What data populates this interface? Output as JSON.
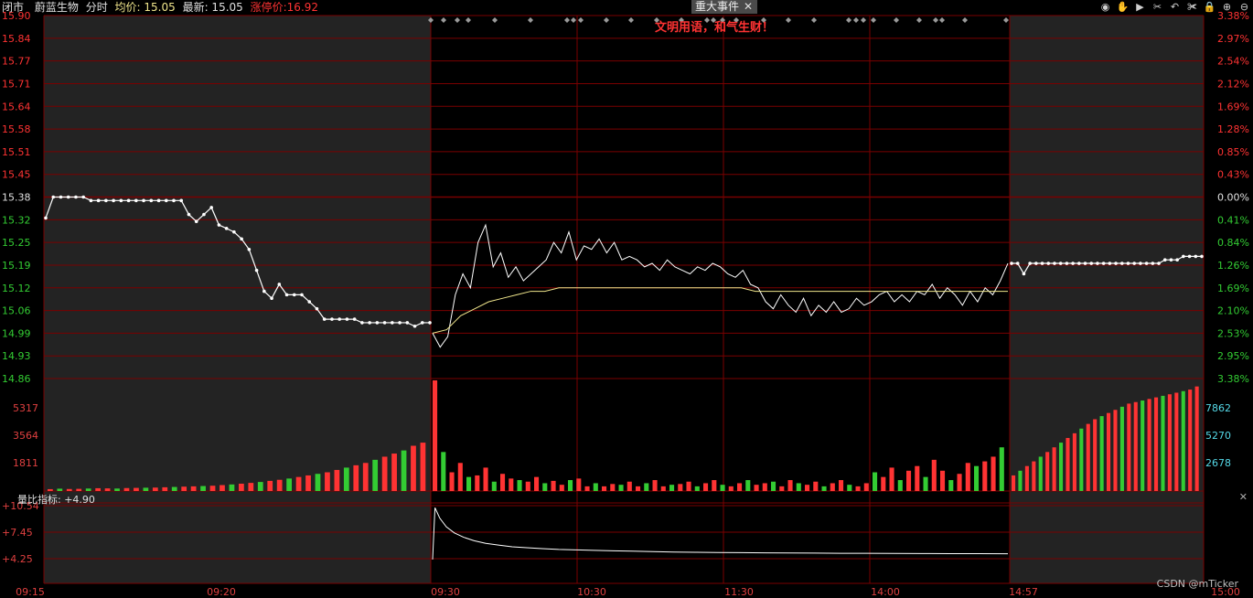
{
  "header": {
    "status": "闭市",
    "stock_name": "蔚蓝生物",
    "mode": "分时",
    "avg_label": "均价: 15.05",
    "last_label": "最新: 15.05",
    "limit_label": "涨停价:16.92",
    "event_tab": "重大事件",
    "event_close": "✕",
    "banner": "文明用语，和气生财！",
    "tools": [
      {
        "name": "eye-icon",
        "glyph": "◉"
      },
      {
        "name": "hand-icon",
        "glyph": "✋"
      },
      {
        "name": "play-icon",
        "glyph": "▶"
      },
      {
        "name": "tools-icon",
        "glyph": "✂"
      },
      {
        "name": "undo-icon",
        "glyph": "↶"
      },
      {
        "name": "scissors-icon",
        "glyph": "✀"
      },
      {
        "name": "lock-icon",
        "glyph": "🔒"
      },
      {
        "name": "zoom-in-icon",
        "glyph": "⊕"
      },
      {
        "name": "zoom-out-icon",
        "glyph": "⊖"
      }
    ]
  },
  "indicator": {
    "title": "量比指标: +4.90",
    "close": "✕"
  },
  "watermark": "CSDN @mTicker",
  "colors": {
    "up": "#ff3333",
    "down": "#33cc33",
    "grid": "#7a0000",
    "price_line": "#ffffff",
    "avg_line": "#f0e68c",
    "session_bg": "#232323",
    "volume_axis": "#55d9e8"
  },
  "chart_data": [
    {
      "type": "line",
      "name": "price",
      "ylim": [
        14.86,
        15.9
      ],
      "y_ticks_left": [
        "15.90",
        "15.84",
        "15.77",
        "15.71",
        "15.64",
        "15.58",
        "15.51",
        "15.45",
        "15.38",
        "15.32",
        "15.25",
        "15.19",
        "15.12",
        "15.06",
        "14.99",
        "14.93",
        "14.86"
      ],
      "y_ticks_right": [
        "3.38%",
        "2.97%",
        "2.54%",
        "2.12%",
        "1.69%",
        "1.28%",
        "0.85%",
        "0.43%",
        "0.00%",
        "0.41%",
        "0.84%",
        "1.26%",
        "1.69%",
        "2.10%",
        "2.53%",
        "2.95%",
        "3.38%"
      ],
      "prev_close": 15.38,
      "x_ticks": [
        "09:15",
        "09:20",
        "09:30",
        "10:30",
        "11:30",
        "14:00",
        "14:57",
        "15:00"
      ],
      "preauction": [
        15.32,
        15.38,
        15.38,
        15.38,
        15.38,
        15.38,
        15.37,
        15.37,
        15.37,
        15.37,
        15.37,
        15.37,
        15.37,
        15.37,
        15.37,
        15.37,
        15.37,
        15.37,
        15.37,
        15.33,
        15.31,
        15.33,
        15.35,
        15.3,
        15.29,
        15.28,
        15.26,
        15.23,
        15.17,
        15.11,
        15.09,
        15.13,
        15.1,
        15.1,
        15.1,
        15.08,
        15.06,
        15.03,
        15.03,
        15.03,
        15.03,
        15.03,
        15.02,
        15.02,
        15.02,
        15.02,
        15.02,
        15.02,
        15.02,
        15.01,
        15.02,
        15.02
      ],
      "session_price": [
        14.99,
        14.95,
        14.98,
        15.1,
        15.16,
        15.12,
        15.25,
        15.3,
        15.18,
        15.22,
        15.15,
        15.18,
        15.14,
        15.16,
        15.18,
        15.2,
        15.25,
        15.22,
        15.28,
        15.2,
        15.24,
        15.23,
        15.26,
        15.22,
        15.25,
        15.2,
        15.21,
        15.2,
        15.18,
        15.19,
        15.17,
        15.2,
        15.18,
        15.17,
        15.16,
        15.18,
        15.17,
        15.19,
        15.18,
        15.16,
        15.15,
        15.17,
        15.13,
        15.12,
        15.08,
        15.06,
        15.1,
        15.07,
        15.05,
        15.09,
        15.04,
        15.07,
        15.05,
        15.08,
        15.05,
        15.06,
        15.09,
        15.07,
        15.08,
        15.1,
        15.11,
        15.08,
        15.1,
        15.08,
        15.11,
        15.1,
        15.13,
        15.09,
        15.12,
        15.1,
        15.07,
        15.11,
        15.08,
        15.12,
        15.1,
        15.14,
        15.19
      ],
      "session_avg": [
        14.99,
        15.0,
        15.04,
        15.06,
        15.08,
        15.09,
        15.1,
        15.11,
        15.11,
        15.12,
        15.12,
        15.12,
        15.12,
        15.12,
        15.12,
        15.12,
        15.12,
        15.12,
        15.12,
        15.12,
        15.12,
        15.12,
        15.12,
        15.11,
        15.11,
        15.11,
        15.11,
        15.11,
        15.11,
        15.11,
        15.11,
        15.11,
        15.11,
        15.11,
        15.11,
        15.11,
        15.11,
        15.11,
        15.11,
        15.11,
        15.11,
        15.11
      ],
      "postclose": [
        15.19,
        15.19,
        15.16,
        15.19,
        15.19,
        15.19,
        15.19,
        15.19,
        15.19,
        15.19,
        15.19,
        15.19,
        15.19,
        15.19,
        15.19,
        15.19,
        15.19,
        15.19,
        15.19,
        15.19,
        15.19,
        15.19,
        15.19,
        15.19,
        15.19,
        15.2,
        15.2,
        15.2,
        15.21,
        15.21,
        15.21,
        15.21
      ]
    },
    {
      "type": "bar",
      "name": "volume",
      "y_ticks_left": [
        "5317",
        "3564",
        "1811"
      ],
      "y_ticks_right": [
        "7862",
        "5270",
        "2678"
      ],
      "ymax": 7090,
      "preauction_volume": [
        120,
        150,
        130,
        140,
        160,
        180,
        170,
        160,
        190,
        200,
        210,
        220,
        240,
        260,
        280,
        300,
        320,
        340,
        380,
        420,
        470,
        520,
        580,
        650,
        720,
        800,
        900,
        1000,
        1100,
        1200,
        1350,
        1500,
        1650,
        1800,
        2000,
        2200,
        2400,
        2600,
        2900,
        3100
      ],
      "session_volume": [
        7090,
        2500,
        1200,
        1800,
        900,
        1000,
        1500,
        600,
        1100,
        800,
        700,
        600,
        900,
        500,
        650,
        400,
        700,
        800,
        300,
        500,
        300,
        450,
        400,
        600,
        300,
        500,
        700,
        300,
        400,
        450,
        600,
        300,
        500,
        700,
        400,
        300,
        500,
        700,
        400,
        500,
        600,
        300,
        700,
        500,
        400,
        600,
        300,
        500,
        700,
        400,
        300,
        500,
        1200,
        900,
        1500,
        700,
        1300,
        1600,
        900,
        2000,
        1300,
        700,
        1100,
        1800,
        1600,
        1900,
        2200,
        2800
      ],
      "postclose_volume": [
        1000,
        1300,
        1600,
        1900,
        2200,
        2500,
        2800,
        3100,
        3400,
        3700,
        4000,
        4300,
        4600,
        4800,
        5000,
        5200,
        5400,
        5600,
        5700,
        5800,
        5900,
        6000,
        6100,
        6200,
        6300,
        6400,
        6500,
        6700
      ]
    },
    {
      "type": "line",
      "name": "量比指标",
      "y_ticks_left": [
        "+10.54",
        "+7.45",
        "+4.25"
      ],
      "ylim": [
        1.5,
        10.54
      ],
      "values": [
        4.25,
        10.2,
        9.0,
        8.0,
        7.3,
        6.8,
        6.4,
        6.1,
        5.9,
        5.7,
        5.6,
        5.5,
        5.4,
        5.35,
        5.3,
        5.25,
        5.2,
        5.15,
        5.1,
        5.08,
        5.05,
        5.03,
        5.01,
        5.0,
        4.98,
        4.96,
        4.95,
        4.94,
        4.93,
        4.92,
        4.91,
        4.9
      ]
    }
  ]
}
